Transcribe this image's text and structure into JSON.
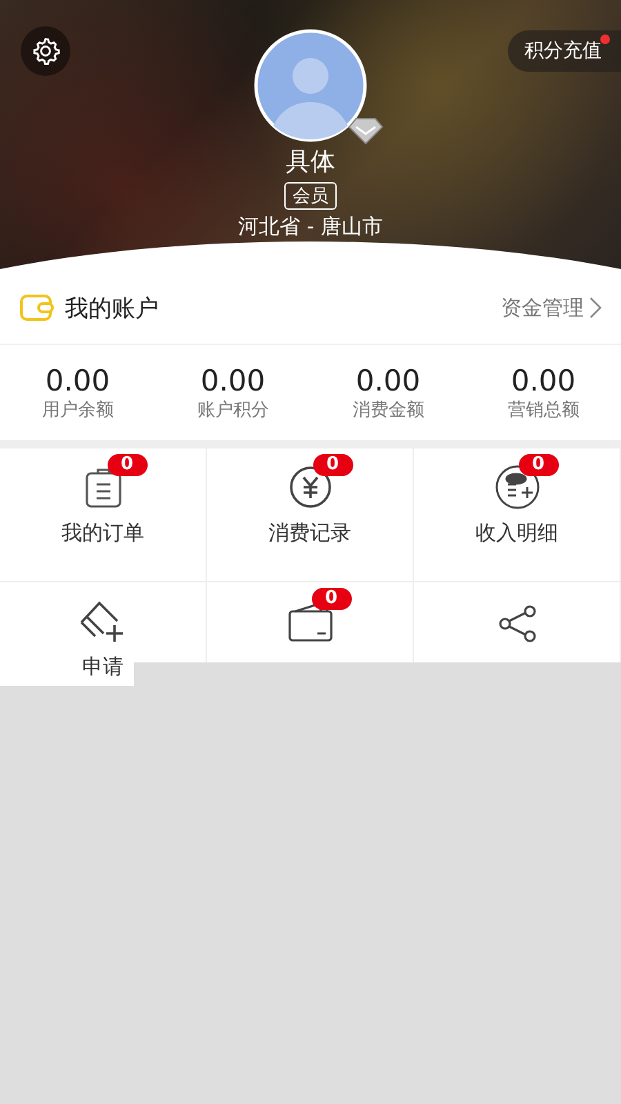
{
  "header": {
    "recharge": {
      "label": "积分充值",
      "has_dot": true
    },
    "user": {
      "name": "具体",
      "tag": "会员",
      "location": "河北省 - 唐山市"
    }
  },
  "account": {
    "title": "我的账户",
    "link": "资金管理"
  },
  "stats": [
    {
      "value": "0.00",
      "label": "用户余额"
    },
    {
      "value": "0.00",
      "label": "账户积分"
    },
    {
      "value": "0.00",
      "label": "消费金额"
    },
    {
      "value": "0.00",
      "label": "营销总额"
    }
  ],
  "menu": [
    {
      "kind": "order",
      "label": "我的订单",
      "badge": "0"
    },
    {
      "kind": "yuan",
      "label": "消费记录",
      "badge": "0"
    },
    {
      "kind": "coins",
      "label": "收入明细",
      "badge": "0"
    },
    {
      "kind": "card",
      "label": "申请"
    },
    {
      "kind": "wallet",
      "badge": "0"
    },
    {
      "kind": "share"
    }
  ]
}
